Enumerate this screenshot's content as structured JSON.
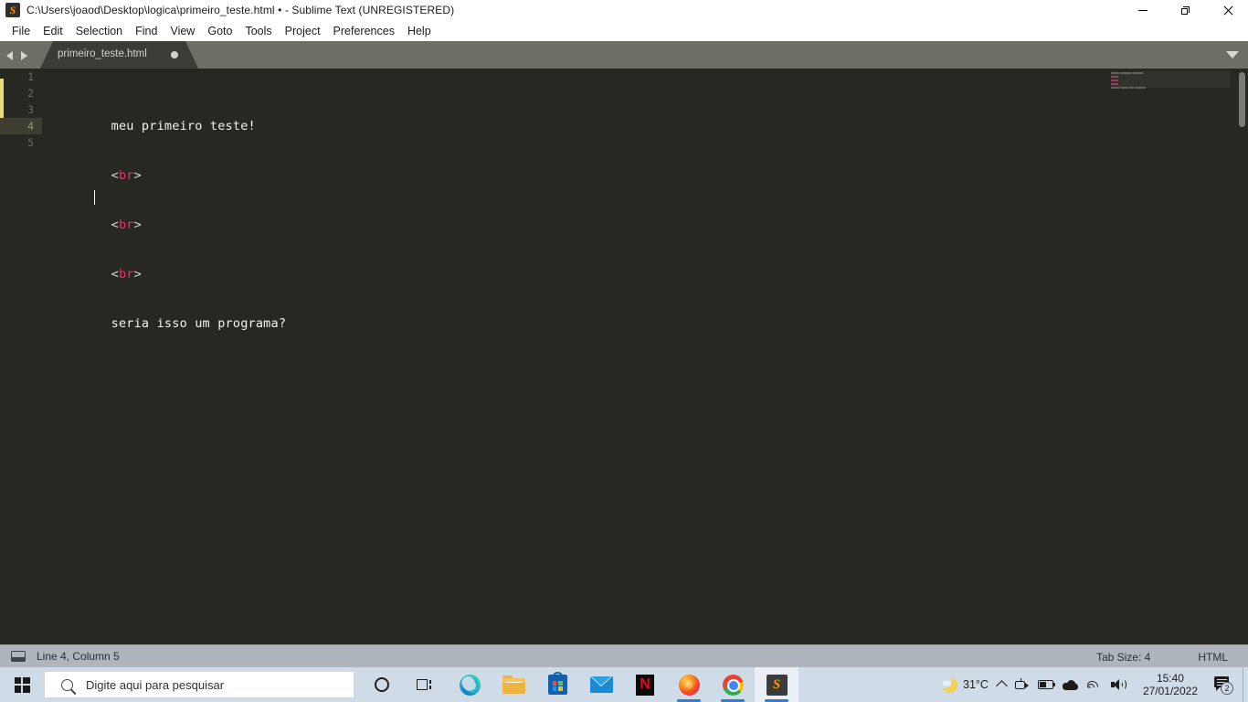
{
  "window": {
    "app_icon": "sublime-text-logo",
    "title": "C:\\Users\\joaod\\Desktop\\logica\\primeiro_teste.html • - Sublime Text (UNREGISTERED)",
    "controls": {
      "minimize": "minimize",
      "maximize": "restore",
      "close": "close"
    }
  },
  "menubar": {
    "items": [
      {
        "label": "File"
      },
      {
        "label": "Edit"
      },
      {
        "label": "Selection"
      },
      {
        "label": "Find"
      },
      {
        "label": "View"
      },
      {
        "label": "Goto"
      },
      {
        "label": "Tools"
      },
      {
        "label": "Project"
      },
      {
        "label": "Preferences"
      },
      {
        "label": "Help"
      }
    ]
  },
  "tabbar": {
    "prev_label": "",
    "next_label": "",
    "tabs": [
      {
        "label": "primeiro_teste.html",
        "dirty": true,
        "active": true
      }
    ],
    "dropdown": "tab-list-dropdown"
  },
  "editor": {
    "active_line": 4,
    "modified_lines": [
      2,
      3,
      4
    ],
    "lines": [
      {
        "number": "1",
        "tokens": [
          {
            "text": "meu primeiro teste!",
            "type": "plain"
          }
        ]
      },
      {
        "number": "2",
        "tokens": [
          {
            "text": "<",
            "type": "punct"
          },
          {
            "text": "br",
            "type": "tag"
          },
          {
            "text": ">",
            "type": "punct"
          }
        ]
      },
      {
        "number": "3",
        "tokens": [
          {
            "text": "<",
            "type": "punct"
          },
          {
            "text": "br",
            "type": "tag"
          },
          {
            "text": ">",
            "type": "punct"
          }
        ]
      },
      {
        "number": "4",
        "tokens": [
          {
            "text": "<",
            "type": "punct"
          },
          {
            "text": "br",
            "type": "tag"
          },
          {
            "text": ">",
            "type": "punct"
          }
        ]
      },
      {
        "number": "5",
        "tokens": [
          {
            "text": "seria isso um programa?",
            "type": "plain"
          }
        ]
      }
    ],
    "colors": {
      "background": "#272822",
      "foreground": "#f4f4ee",
      "tag": "#f92672",
      "punct": "#d8d8d2",
      "active_line": "#3e3d32",
      "gutter_text": "#6c6c5e",
      "modified_marker": "#e6db74"
    }
  },
  "statusbar": {
    "console_icon": "console-panel-icon",
    "position": "Line 4, Column 5",
    "tab_size": "Tab Size: 4",
    "syntax": "HTML"
  },
  "taskbar": {
    "start_label": "Start",
    "search_placeholder": "Digite aqui para pesquisar",
    "search_value": "",
    "items": [
      {
        "name": "cortana",
        "label": "Cortana",
        "running": false,
        "active": false
      },
      {
        "name": "task-view",
        "label": "Task View",
        "running": false,
        "active": false
      },
      {
        "name": "microsoft-edge",
        "label": "Microsoft Edge",
        "running": false,
        "active": false
      },
      {
        "name": "file-explorer",
        "label": "File Explorer",
        "running": false,
        "active": false
      },
      {
        "name": "microsoft-store",
        "label": "Microsoft Store",
        "running": false,
        "active": false
      },
      {
        "name": "mail",
        "label": "Mail",
        "running": false,
        "active": false
      },
      {
        "name": "netflix",
        "label": "Netflix",
        "running": false,
        "active": false
      },
      {
        "name": "firefox",
        "label": "Mozilla Firefox",
        "running": true,
        "active": false
      },
      {
        "name": "google-chrome",
        "label": "Google Chrome",
        "running": true,
        "active": false
      },
      {
        "name": "sublime-text",
        "label": "Sublime Text",
        "running": true,
        "active": true
      }
    ],
    "netflix_glyph": "N",
    "sublime_glyph": "S",
    "tray": {
      "weather_icon": "moon-night-icon",
      "temperature": "31°C",
      "show_hidden_icons": "show-hidden-icons",
      "icons": [
        {
          "name": "meet-now-icon",
          "label": "Meet Now"
        },
        {
          "name": "battery-icon",
          "label": "Battery"
        },
        {
          "name": "onedrive-icon",
          "label": "OneDrive"
        },
        {
          "name": "wifi-icon",
          "label": "Network"
        },
        {
          "name": "volume-icon",
          "label": "Volume"
        }
      ],
      "time": "15:40",
      "date": "27/01/2022",
      "notifications_count": "2"
    }
  }
}
